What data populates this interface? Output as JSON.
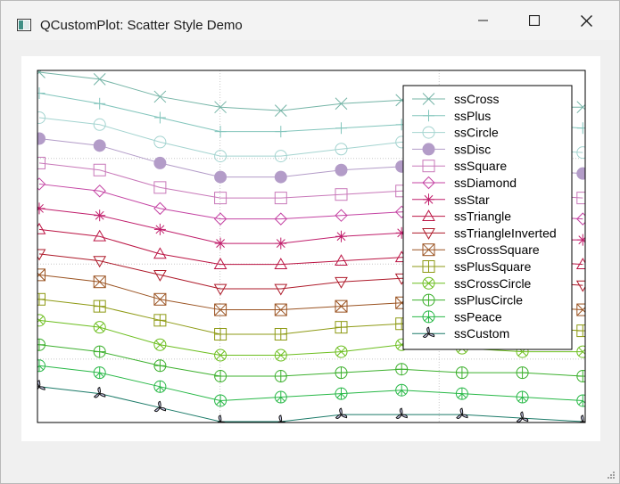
{
  "window": {
    "title": "QCustomPlot: Scatter Style Demo",
    "icons": {
      "app": "app-window-icon",
      "minimize": "minimize-icon",
      "maximize": "maximize-icon",
      "close": "close-icon"
    }
  },
  "chart_data": {
    "type": "scatter",
    "title": "",
    "xlabel": "",
    "ylabel": "",
    "grid": true,
    "axes_tick_labels": false,
    "legend_position": "top-right",
    "series": [
      {
        "name": "ssCross",
        "style": "cross",
        "color": "#74b4a6",
        "points": [
          [
            0,
            0.0
          ],
          [
            1,
            0.02
          ],
          [
            2,
            0.07
          ],
          [
            3,
            0.1
          ],
          [
            4,
            0.11
          ],
          [
            5,
            0.09
          ],
          [
            6,
            0.08
          ],
          [
            7,
            0.09
          ],
          [
            8,
            0.1
          ],
          [
            9,
            0.1
          ]
        ]
      },
      {
        "name": "ssPlus",
        "style": "plus",
        "color": "#82c5bc",
        "points": [
          [
            0,
            0.06
          ],
          [
            1,
            0.09
          ],
          [
            2,
            0.13
          ],
          [
            3,
            0.17
          ],
          [
            4,
            0.17
          ],
          [
            5,
            0.16
          ],
          [
            6,
            0.15
          ],
          [
            7,
            0.14
          ],
          [
            8,
            0.15
          ],
          [
            9,
            0.16
          ]
        ]
      },
      {
        "name": "ssCircle",
        "style": "circle",
        "color": "#a4d4d0",
        "points": [
          [
            0,
            0.13
          ],
          [
            1,
            0.15
          ],
          [
            2,
            0.2
          ],
          [
            3,
            0.24
          ],
          [
            4,
            0.24
          ],
          [
            5,
            0.22
          ],
          [
            6,
            0.2
          ],
          [
            7,
            0.21
          ],
          [
            8,
            0.22
          ],
          [
            9,
            0.23
          ]
        ]
      },
      {
        "name": "ssDisc",
        "style": "disc",
        "color": "#b39cc8",
        "points": [
          [
            0,
            0.19
          ],
          [
            1,
            0.21
          ],
          [
            2,
            0.26
          ],
          [
            3,
            0.3
          ],
          [
            4,
            0.3
          ],
          [
            5,
            0.28
          ],
          [
            6,
            0.27
          ],
          [
            7,
            0.27
          ],
          [
            8,
            0.28
          ],
          [
            9,
            0.29
          ]
        ]
      },
      {
        "name": "ssSquare",
        "style": "square",
        "color": "#c878b9",
        "points": [
          [
            0,
            0.26
          ],
          [
            1,
            0.28
          ],
          [
            2,
            0.33
          ],
          [
            3,
            0.36
          ],
          [
            4,
            0.36
          ],
          [
            5,
            0.35
          ],
          [
            6,
            0.34
          ],
          [
            7,
            0.34
          ],
          [
            8,
            0.35
          ],
          [
            9,
            0.36
          ]
        ]
      },
      {
        "name": "ssDiamond",
        "style": "diamond",
        "color": "#c443a3",
        "points": [
          [
            0,
            0.32
          ],
          [
            1,
            0.34
          ],
          [
            2,
            0.39
          ],
          [
            3,
            0.42
          ],
          [
            4,
            0.42
          ],
          [
            5,
            0.41
          ],
          [
            6,
            0.4
          ],
          [
            7,
            0.4
          ],
          [
            8,
            0.41
          ],
          [
            9,
            0.42
          ]
        ]
      },
      {
        "name": "ssStar",
        "style": "star",
        "color": "#c01e6b",
        "points": [
          [
            0,
            0.39
          ],
          [
            1,
            0.41
          ],
          [
            2,
            0.45
          ],
          [
            3,
            0.49
          ],
          [
            4,
            0.49
          ],
          [
            5,
            0.47
          ],
          [
            6,
            0.46
          ],
          [
            7,
            0.47
          ],
          [
            8,
            0.48
          ],
          [
            9,
            0.48
          ]
        ]
      },
      {
        "name": "ssTriangle",
        "style": "triangle",
        "color": "#bb1443",
        "points": [
          [
            0,
            0.45
          ],
          [
            1,
            0.47
          ],
          [
            2,
            0.52
          ],
          [
            3,
            0.55
          ],
          [
            4,
            0.55
          ],
          [
            5,
            0.54
          ],
          [
            6,
            0.53
          ],
          [
            7,
            0.53
          ],
          [
            8,
            0.54
          ],
          [
            9,
            0.55
          ]
        ]
      },
      {
        "name": "ssTriangleInverted",
        "style": "triangle-inverted",
        "color": "#ae1a2a",
        "points": [
          [
            0,
            0.52
          ],
          [
            1,
            0.54
          ],
          [
            2,
            0.58
          ],
          [
            3,
            0.62
          ],
          [
            4,
            0.62
          ],
          [
            5,
            0.6
          ],
          [
            6,
            0.59
          ],
          [
            7,
            0.59
          ],
          [
            8,
            0.6
          ],
          [
            9,
            0.61
          ]
        ]
      },
      {
        "name": "ssCrossSquare",
        "style": "cross-square",
        "color": "#9a5220",
        "points": [
          [
            0,
            0.58
          ],
          [
            1,
            0.6
          ],
          [
            2,
            0.65
          ],
          [
            3,
            0.68
          ],
          [
            4,
            0.68
          ],
          [
            5,
            0.67
          ],
          [
            6,
            0.66
          ],
          [
            7,
            0.66
          ],
          [
            8,
            0.67
          ],
          [
            9,
            0.68
          ]
        ]
      },
      {
        "name": "ssPlusSquare",
        "style": "plus-square",
        "color": "#8e9a14",
        "points": [
          [
            0,
            0.65
          ],
          [
            1,
            0.67
          ],
          [
            2,
            0.71
          ],
          [
            3,
            0.75
          ],
          [
            4,
            0.75
          ],
          [
            5,
            0.73
          ],
          [
            6,
            0.72
          ],
          [
            7,
            0.72
          ],
          [
            8,
            0.73
          ],
          [
            9,
            0.74
          ]
        ]
      },
      {
        "name": "ssCrossCircle",
        "style": "cross-circle",
        "color": "#6cbe1e",
        "points": [
          [
            0,
            0.71
          ],
          [
            1,
            0.73
          ],
          [
            2,
            0.78
          ],
          [
            3,
            0.81
          ],
          [
            4,
            0.81
          ],
          [
            5,
            0.8
          ],
          [
            6,
            0.78
          ],
          [
            7,
            0.79
          ],
          [
            8,
            0.8
          ],
          [
            9,
            0.8
          ]
        ]
      },
      {
        "name": "ssPlusCircle",
        "style": "plus-circle",
        "color": "#3cb02d",
        "points": [
          [
            0,
            0.78
          ],
          [
            1,
            0.8
          ],
          [
            2,
            0.84
          ],
          [
            3,
            0.87
          ],
          [
            4,
            0.87
          ],
          [
            5,
            0.86
          ],
          [
            6,
            0.85
          ],
          [
            7,
            0.86
          ],
          [
            8,
            0.86
          ],
          [
            9,
            0.87
          ]
        ]
      },
      {
        "name": "ssPeace",
        "style": "peace",
        "color": "#27b846",
        "points": [
          [
            0,
            0.84
          ],
          [
            1,
            0.86
          ],
          [
            2,
            0.9
          ],
          [
            3,
            0.94
          ],
          [
            4,
            0.93
          ],
          [
            5,
            0.92
          ],
          [
            6,
            0.91
          ],
          [
            7,
            0.92
          ],
          [
            8,
            0.93
          ],
          [
            9,
            0.94
          ]
        ]
      },
      {
        "name": "ssCustom",
        "style": "custom",
        "color": "#1b7a68",
        "fill": "#c9ccec",
        "points": [
          [
            0,
            0.9
          ],
          [
            1,
            0.92
          ],
          [
            2,
            0.96
          ],
          [
            3,
            1.0
          ],
          [
            4,
            1.0
          ],
          [
            5,
            0.98
          ],
          [
            6,
            0.98
          ],
          [
            7,
            0.98
          ],
          [
            8,
            0.99
          ],
          [
            9,
            1.0
          ]
        ]
      }
    ]
  }
}
